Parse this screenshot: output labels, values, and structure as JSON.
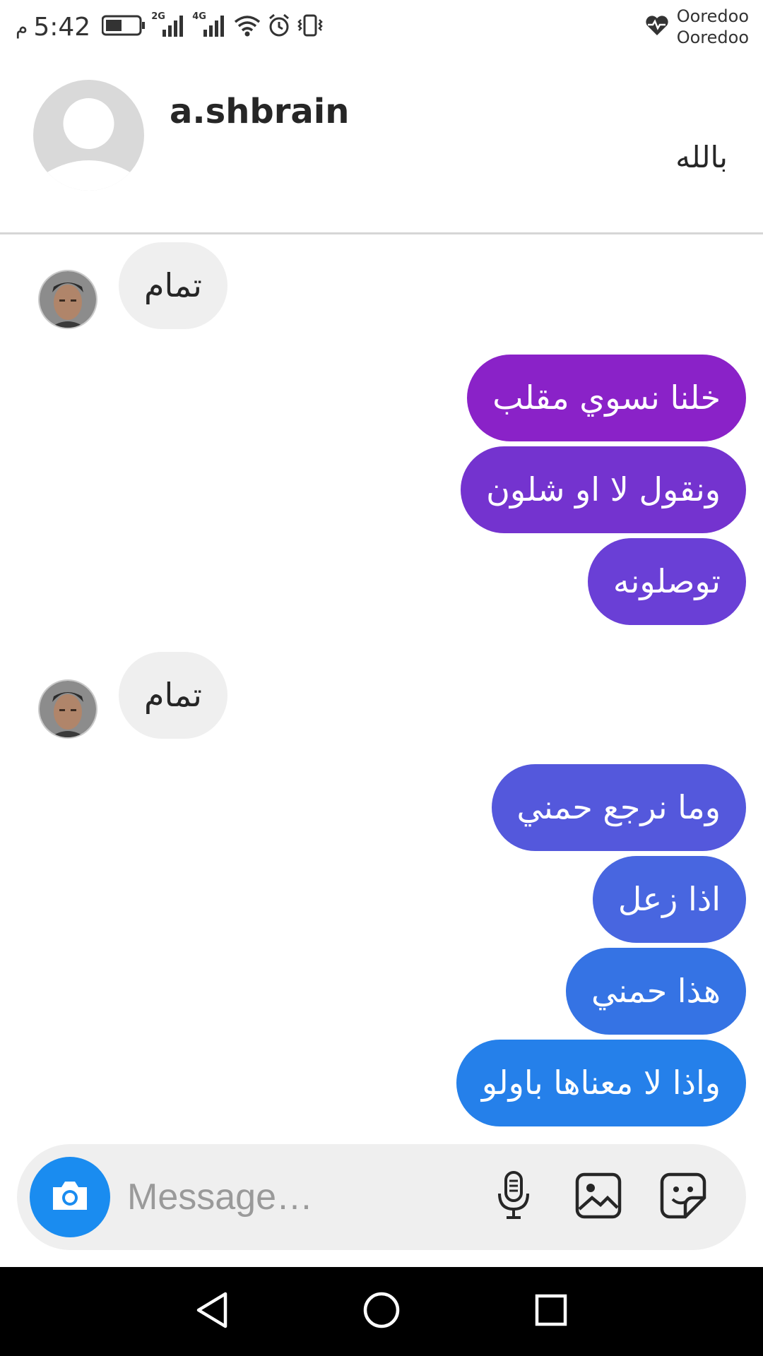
{
  "status_bar": {
    "ampm": "م",
    "time": "5:42",
    "net1": "2G",
    "net2": "4G",
    "carrier1": "Ooredoo",
    "carrier2": "Ooredoo"
  },
  "header": {
    "username": "a.shbrain",
    "subtitle": "بالله"
  },
  "messages": [
    {
      "direction": "incoming",
      "text": "تمام"
    },
    {
      "direction": "outgoing",
      "text": "خلنا نسوي مقلب"
    },
    {
      "direction": "outgoing",
      "text": "ونقول لا او شلون"
    },
    {
      "direction": "outgoing",
      "text": "توصلونه"
    },
    {
      "direction": "incoming",
      "text": "تمام"
    },
    {
      "direction": "outgoing",
      "text": "وما نرجع حمني"
    },
    {
      "direction": "outgoing",
      "text": "اذا زعل"
    },
    {
      "direction": "outgoing",
      "text": "هذا حمني"
    },
    {
      "direction": "outgoing",
      "text": "واذا لا معناها باولو"
    }
  ],
  "composer": {
    "placeholder": "Message…",
    "icons": [
      "camera-icon",
      "microphone-icon",
      "gallery-icon",
      "sticker-icon"
    ]
  },
  "nav_bar": {
    "icons": [
      "back-icon",
      "home-icon",
      "recents-icon"
    ]
  },
  "colors": {
    "incoming_bubble": "#efefef",
    "camera_button": "#1a8cf0",
    "outgoing_gradient": [
      "#8a22c8",
      "#7433cf",
      "#6a3fd6",
      "#5458dc",
      "#4866e0",
      "#3573e4",
      "#2580ea"
    ]
  }
}
